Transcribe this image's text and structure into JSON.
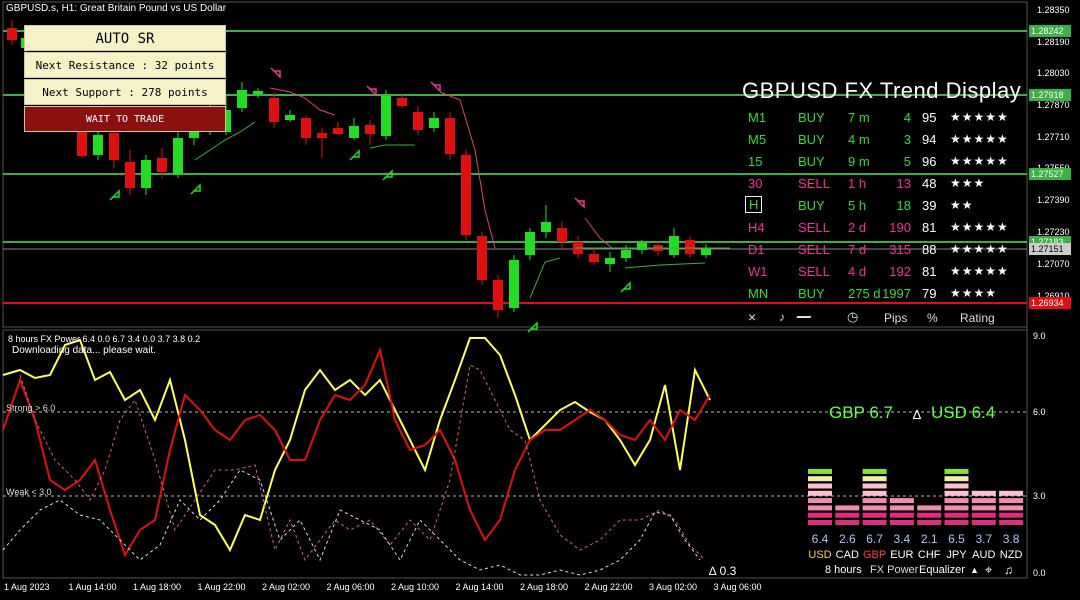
{
  "window": {
    "title": "GBPUSD.s, H1:  Great Britain Pound vs US Dollar",
    "indicator_title": "8 hours FX Power 6.4 0.0 6.7 3.4 0.0 3.7 3.8 0.2",
    "status": "Downloading data... please wait."
  },
  "auto_sr": {
    "title": "AUTO SR",
    "resistance": "Next Resistance : 32 points",
    "support": "Next Support : 278 points",
    "action": "WAIT TO TRADE"
  },
  "price_axis": {
    "labels": [
      "1.28350",
      "1.28190",
      "1.28030",
      "1.27870",
      "1.27710",
      "1.27550",
      "1.27390",
      "1.27230",
      "1.27070",
      "1.26910"
    ],
    "tags": [
      {
        "value": "1.28242",
        "color": "#3cb043"
      },
      {
        "value": "1.27918",
        "color": "#3cb043"
      },
      {
        "value": "1.27527",
        "color": "#3cb043"
      },
      {
        "value": "1.27183",
        "color": "#3cb043"
      },
      {
        "value": "1.26934",
        "color": "#e01010"
      }
    ],
    "current": "1.27151"
  },
  "trend_display": {
    "title": "GBPUSD FX Trend Display",
    "rows": [
      {
        "tf": "M1",
        "dir": "BUY",
        "dur": "7 m",
        "pips": "4",
        "pct": "95",
        "stars": "★★★★★"
      },
      {
        "tf": "M5",
        "dir": "BUY",
        "dur": "4 m",
        "pips": "3",
        "pct": "94",
        "stars": "★★★★★"
      },
      {
        "tf": "15",
        "dir": "BUY",
        "dur": "9 m",
        "pips": "5",
        "pct": "96",
        "stars": "★★★★★"
      },
      {
        "tf": "30",
        "dir": "SELL",
        "dur": "1 h",
        "pips": "13",
        "pct": "48",
        "stars": "★★★"
      },
      {
        "tf": "H",
        "dir": "BUY",
        "dur": "5 h",
        "pips": "18",
        "pct": "39",
        "stars": "★★"
      },
      {
        "tf": "H4",
        "dir": "SELL",
        "dur": "2 d",
        "pips": "190",
        "pct": "81",
        "stars": "★★★★★"
      },
      {
        "tf": "D1",
        "dir": "SELL",
        "dur": "7 d",
        "pips": "315",
        "pct": "88",
        "stars": "★★★★★"
      },
      {
        "tf": "W1",
        "dir": "SELL",
        "dur": "4 d",
        "pips": "192",
        "pct": "81",
        "stars": "★★★★★"
      },
      {
        "tf": "MN",
        "dir": "BUY",
        "dur": "275 d",
        "pips": "1997",
        "pct": "79",
        "stars": "★★★★"
      }
    ],
    "footer": {
      "close": "×",
      "pips": "Pips",
      "pct": "%",
      "rating": "Rating"
    }
  },
  "fx_power": {
    "strong_label": "Strong > 6.0",
    "weak_label": "Weak < 3.0",
    "readout_left": "GBP 6.7",
    "readout_delta": "∆",
    "readout_right": "USD 6.4",
    "delta_value": "∆ 0.3",
    "axis_labels": [
      "9.0",
      "6.0",
      "3.0",
      "0.0"
    ],
    "currencies": [
      "USD",
      "CAD",
      "GBP",
      "EUR",
      "CHF",
      "JPY",
      "AUD",
      "NZD"
    ],
    "values": [
      "6.4",
      "2.6",
      "6.7",
      "3.4",
      "2.1",
      "6.5",
      "3.7",
      "3.8"
    ],
    "footer": {
      "period": "8 hours",
      "name": "FX Power",
      "equalizer": "Equalizer",
      "arrow": "▲"
    }
  },
  "time_axis": [
    "1 Aug 2023",
    "1 Aug 14:00",
    "1 Aug 18:00",
    "1 Aug 22:00",
    "2 Aug 02:00",
    "2 Aug 06:00",
    "2 Aug 10:00",
    "2 Aug 14:00",
    "2 Aug 18:00",
    "2 Aug 22:00",
    "3 Aug 02:00",
    "3 Aug 06:00"
  ],
  "colors": {
    "bull": "#22dd22",
    "bear": "#e01010",
    "support_line": "#3cb043",
    "resistance_line": "#e01010",
    "gbp": "#ffff55",
    "usd": "#e01010",
    "accent_green": "#66ff44"
  }
}
